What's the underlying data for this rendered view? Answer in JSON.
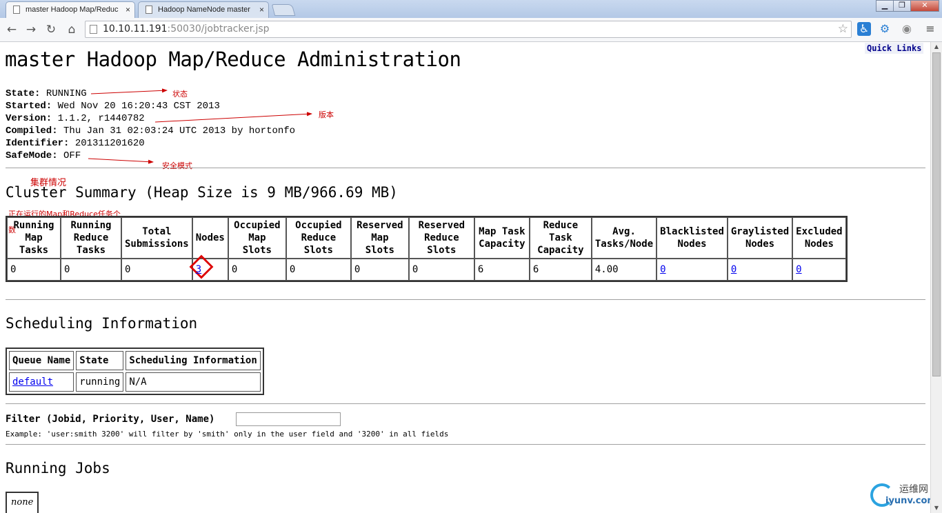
{
  "browser": {
    "tabs": [
      {
        "title": "master Hadoop Map/Reduc",
        "close": "×"
      },
      {
        "title": "Hadoop NameNode master",
        "close": "×"
      }
    ],
    "window_controls": [
      "▁",
      "❐",
      "✕"
    ],
    "url_host": "10.10.11.191",
    "url_rest": ":50030/jobtracker.jsp"
  },
  "page": {
    "quick_links": "Quick Links",
    "title": "master Hadoop Map/Reduce Administration",
    "info": [
      {
        "label": "State:",
        "value": "RUNNING"
      },
      {
        "label": "Started:",
        "value": "Wed Nov 20 16:20:43 CST 2013"
      },
      {
        "label": "Version:",
        "value": "1.1.2, r1440782"
      },
      {
        "label": "Compiled:",
        "value": "Thu Jan 31 02:03:24 UTC 2013 by hortonfo"
      },
      {
        "label": "Identifier:",
        "value": "201311201620"
      },
      {
        "label": "SafeMode:",
        "value": "OFF"
      }
    ],
    "cluster_summary_title": "Cluster Summary (Heap Size is 9 MB/966.69 MB)",
    "summary_headers": [
      "Running Map Tasks",
      "Running Reduce Tasks",
      "Total Submissions",
      "Nodes",
      "Occupied Map Slots",
      "Occupied Reduce Slots",
      "Reserved Map Slots",
      "Reserved Reduce Slots",
      "Map Task Capacity",
      "Reduce Task Capacity",
      "Avg. Tasks/Node",
      "Blacklisted Nodes",
      "Graylisted Nodes",
      "Excluded Nodes"
    ],
    "summary_values": [
      "0",
      "0",
      "0",
      "3",
      "0",
      "0",
      "0",
      "0",
      "6",
      "6",
      "4.00",
      "0",
      "0",
      "0"
    ],
    "scheduling_title": "Scheduling Information",
    "scheduling_headers": [
      "Queue Name",
      "State",
      "Scheduling Information"
    ],
    "scheduling_row": [
      "default",
      "running",
      "N/A"
    ],
    "filter_label": "Filter (Jobid, Priority, User, Name)",
    "filter_example": "Example: 'user:smith 3200' will filter by 'smith' only in the user field and '3200' in all fields",
    "running_jobs_title": "Running Jobs",
    "running_jobs_empty": "none"
  },
  "annotations": {
    "state": "状态",
    "version": "版本",
    "safemode": "安全模式",
    "cluster": "集群情况",
    "running_tasks_line1": "正在运行的Map和Reduce任务个",
    "running_tasks_line2": "数"
  },
  "watermark": {
    "cn": "运维网",
    "en": "iyunv.com"
  },
  "colors": {
    "annotation": "#cc0000",
    "link": "#0000ee",
    "quick_links": "#00008b"
  }
}
